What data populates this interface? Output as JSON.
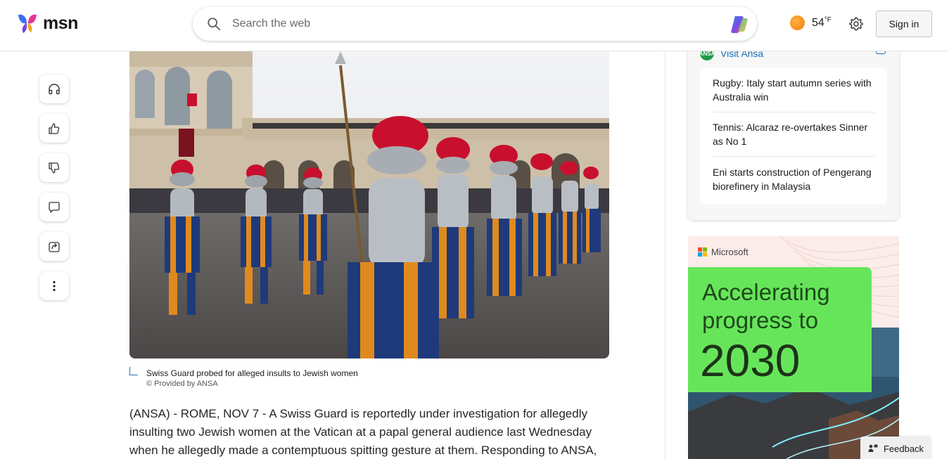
{
  "header": {
    "logo_text": "msn",
    "search_placeholder": "Search the web",
    "temperature": "54",
    "temperature_unit": "°F",
    "signin_label": "Sign in"
  },
  "rail": {
    "icons": [
      "headphones-icon",
      "thumbs-up-icon",
      "thumbs-down-icon",
      "comment-icon",
      "share-icon",
      "more-icon"
    ]
  },
  "article": {
    "image_caption": "Swiss Guard probed for alleged insults to Jewish women",
    "image_credit": "© Provided by ANSA",
    "body": "(ANSA) - ROME, NOV 7 - A Swiss Guard is reportedly under investigation for allegedly insulting two Jewish women at the Vatican at a papal general audience last Wednesday when he allegedly made a contemptuous spitting gesture at them. Responding to ANSA,"
  },
  "sidebar": {
    "visit_label": "Visit Ansa",
    "news": [
      "Rugby: Italy start autumn series with Australia win",
      "Tennis: Alcaraz re-overtakes Sinner as No 1",
      "Eni starts construction of Pengerang biorefinery in Malaysia"
    ]
  },
  "ad": {
    "brand": "Microsoft",
    "headline": "Accelerating progress to",
    "year": "2030"
  },
  "feedback_label": "Feedback",
  "colors": {
    "link_blue": "#1b6fb5",
    "ad_green": "#67e55a",
    "weather_sun": "#f07d00"
  }
}
